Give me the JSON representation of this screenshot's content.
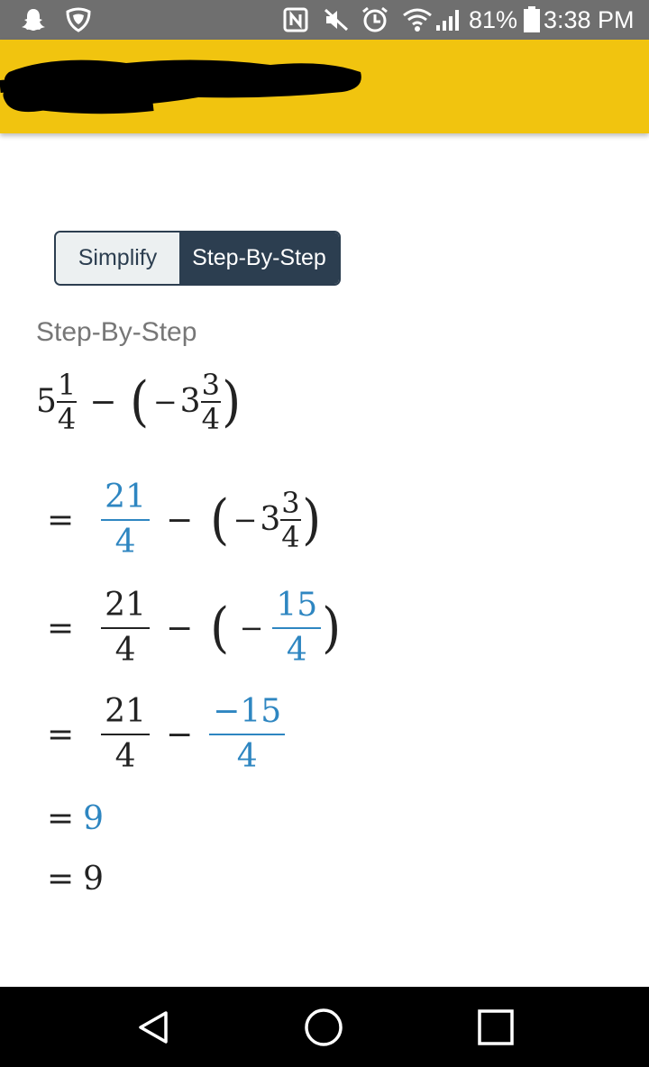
{
  "status_bar": {
    "battery": "81%",
    "time": "3:38 PM",
    "icons": [
      "snapchat-icon",
      "vpn-shield-icon",
      "nfc-icon",
      "mute-icon",
      "alarm-icon",
      "wifi-icon",
      "signal-icon",
      "battery-icon"
    ]
  },
  "app_bar": {
    "title_redacted": true,
    "background_color": "#f1c40f"
  },
  "toggle": {
    "simplify_label": "Simplify",
    "step_label": "Step-By-Step",
    "selected": "Step-By-Step"
  },
  "section_title": "Step-By-Step",
  "steps": {
    "s0": {
      "whole": "5",
      "n1": "1",
      "d1": "4",
      "op": "−",
      "neg": "−",
      "whole2": "3",
      "n2": "3",
      "d2": "4"
    },
    "s1": {
      "eq": "=",
      "n1": "21",
      "d1": "4",
      "op": "−",
      "neg": "−",
      "whole2": "3",
      "n2": "3",
      "d2": "4"
    },
    "s2": {
      "eq": "=",
      "n1": "21",
      "d1": "4",
      "op": "−",
      "neg": "−",
      "n2": "15",
      "d2": "4"
    },
    "s3": {
      "eq": "=",
      "n1": "21",
      "d1": "4",
      "op": "−",
      "n2": "−15",
      "d2": "4"
    },
    "s4": {
      "eq": "=",
      "val": "9"
    },
    "s5": {
      "eq": "=",
      "val": "9"
    }
  },
  "colors": {
    "highlight": "#2e86c1",
    "dark": "#2c3e50"
  },
  "nav": {
    "icons": [
      "back-icon",
      "home-icon",
      "recents-icon"
    ]
  }
}
